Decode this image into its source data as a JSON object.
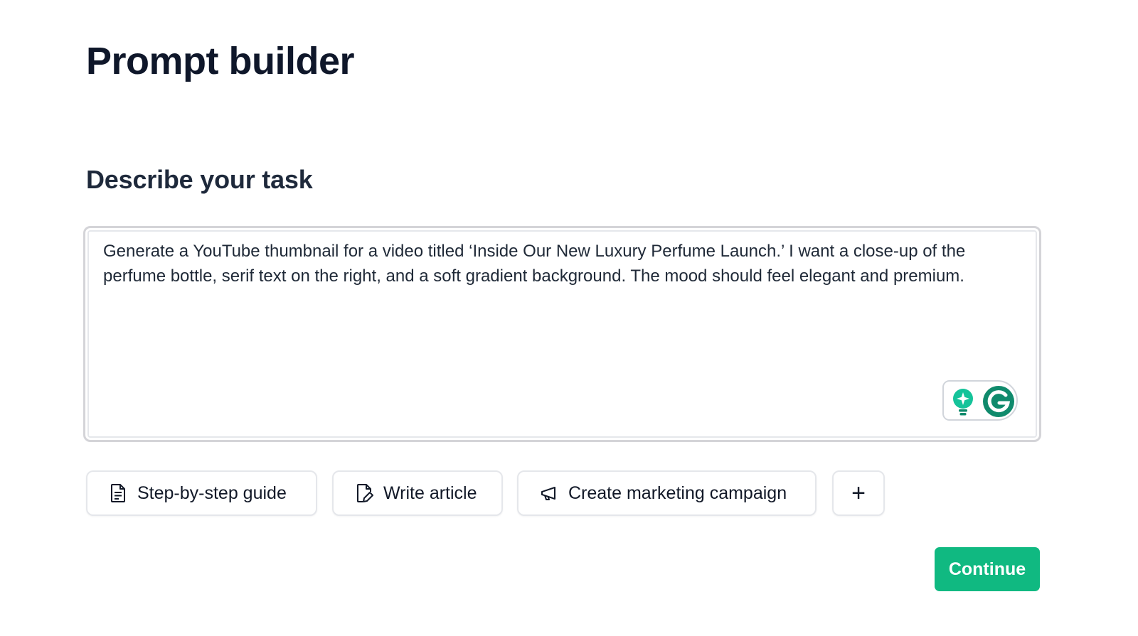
{
  "page": {
    "title": "Prompt builder"
  },
  "task": {
    "heading": "Describe your task",
    "value": "Generate a YouTube thumbnail for a video titled ‘Inside Our New Luxury Perfume Launch.’ I want a close-up of the perfume bottle, serif text on the right, and a soft gradient background. The mood should feel elegant and premium.",
    "assistant_icons": [
      "lightbulb-sparkle-icon",
      "grammarly-g-icon"
    ]
  },
  "templates": [
    {
      "label": "Step-by-step guide",
      "icon": "document-icon"
    },
    {
      "label": "Write article",
      "icon": "pen-document-icon"
    },
    {
      "label": "Create marketing campaign",
      "icon": "megaphone-icon"
    }
  ],
  "add_template": {
    "label": "+",
    "icon": "plus-icon"
  },
  "actions": {
    "continue_label": "Continue"
  },
  "colors": {
    "accent": "#10b981",
    "grammarly": "#15c39a",
    "grammarly_dark": "#0f8a6c",
    "title": "#0f172a",
    "border": "#d4d4d8"
  }
}
